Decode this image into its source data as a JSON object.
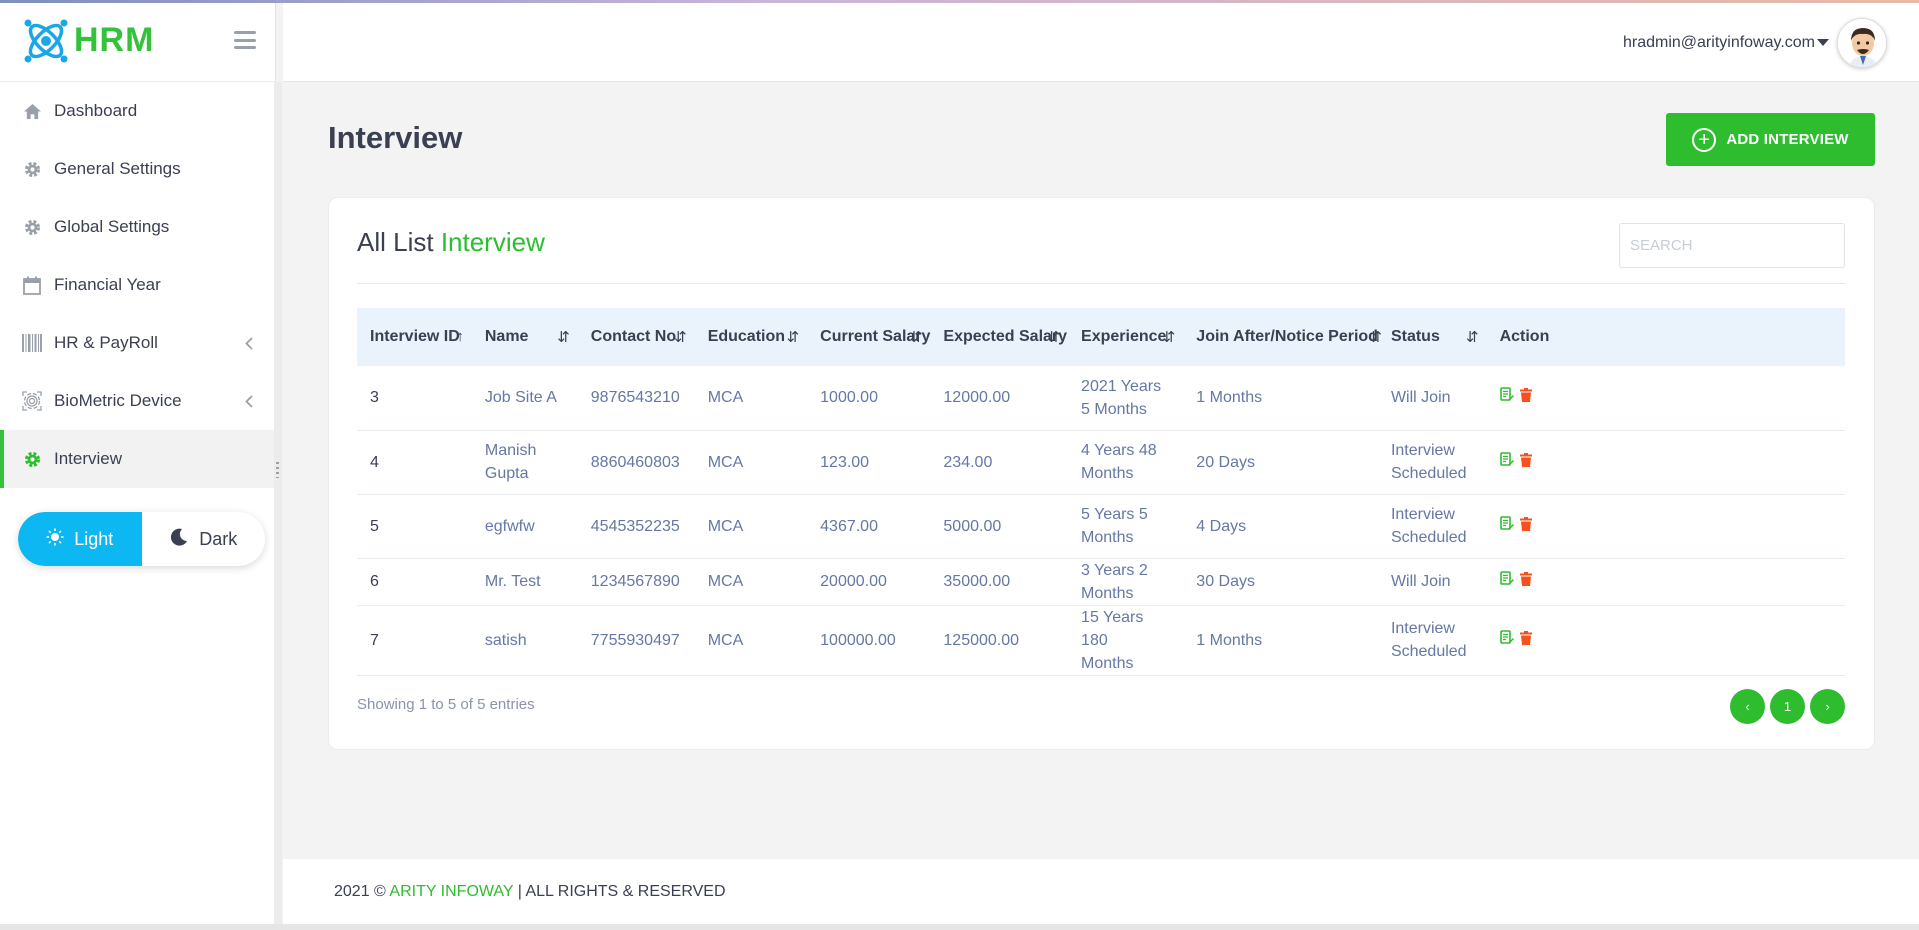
{
  "brand": {
    "name": "HRM",
    "accent_color": "#33c23a"
  },
  "sidebar": {
    "items": [
      {
        "label": "Dashboard",
        "icon": "home-icon"
      },
      {
        "label": "General Settings",
        "icon": "gear-icon"
      },
      {
        "label": "Global Settings",
        "icon": "gear-icon"
      },
      {
        "label": "Financial Year",
        "icon": "calendar-icon"
      },
      {
        "label": "HR & PayRoll",
        "icon": "barcode-icon",
        "expandable": true
      },
      {
        "label": "BioMetric Device",
        "icon": "fingerprint-icon",
        "expandable": true
      },
      {
        "label": "Interview",
        "icon": "gear-icon",
        "active": true
      }
    ],
    "theme": {
      "light_label": "Light",
      "dark_label": "Dark",
      "selected": "Light"
    }
  },
  "header": {
    "user_email": "hradmin@arityinfoway.com"
  },
  "main": {
    "title": "Interview",
    "add_button_label": "ADD INTERVIEW",
    "card": {
      "title_prefix": "All List",
      "title_accent": "Interview",
      "search_placeholder": "SEARCH"
    },
    "table": {
      "columns": [
        "Interview ID",
        "Name",
        "Contact No",
        "Education",
        "Current Salary",
        "Expected Salary",
        "Experience",
        "Join After/Notice Period",
        "Status",
        "Action"
      ],
      "sort_glyphs": [
        "↑",
        "⇵",
        "⇵",
        "⇵",
        "⇵",
        "⇵",
        "⇵",
        "⇵",
        "⇵"
      ],
      "rows": [
        [
          "3",
          "Job Site A",
          "9876543210",
          "MCA",
          "1000.00",
          "12000.00",
          "2021 Years 5 Months",
          "1 Months",
          "Will Join"
        ],
        [
          "4",
          "Manish Gupta",
          "8860460803",
          "MCA",
          "123.00",
          "234.00",
          "4 Years 48 Months",
          "20 Days",
          "Interview Scheduled"
        ],
        [
          "5",
          "egfwfw",
          "4545352235",
          "MCA",
          "4367.00",
          "5000.00",
          "5 Years 5 Months",
          "4 Days",
          "Interview Scheduled"
        ],
        [
          "6",
          "Mr. Test",
          "1234567890",
          "MCA",
          "20000.00",
          "35000.00",
          "3 Years 2 Months",
          "30 Days",
          "Will Join"
        ],
        [
          "7",
          "satish",
          "7755930497",
          "MCA",
          "100000.00",
          "125000.00",
          "15 Years 180 Months",
          "1 Months",
          "Interview Scheduled"
        ]
      ]
    },
    "showing_text": "Showing 1 to 5 of 5 entries",
    "pagination": {
      "prev": "‹",
      "current": "1",
      "next": "›"
    }
  },
  "footer": {
    "year": "2021 ©",
    "brand": "ARITY INFOWAY",
    "rights": "| ALL RIGHTS & RESERVED"
  },
  "colors": {
    "primary_green": "#2ebd2f",
    "light_toggle": "#0cb7f2",
    "edit_icon": "#2ebd2f",
    "delete_icon": "#f4511e"
  }
}
